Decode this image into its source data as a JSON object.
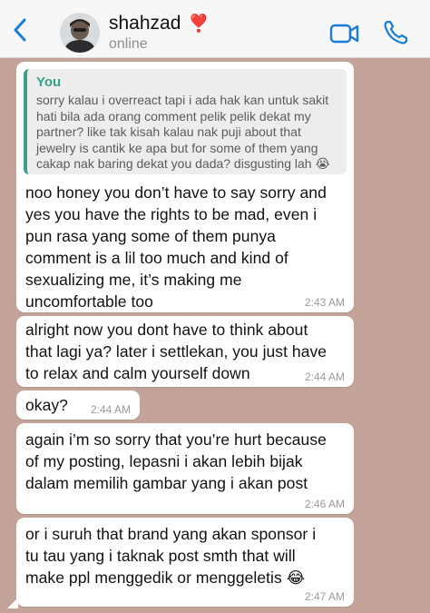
{
  "header": {
    "contact_name": "shahzad",
    "contact_emoji": "❣️",
    "status": "online",
    "icons": {
      "back": "chevron-left-icon",
      "video": "video-camera-icon",
      "call": "phone-icon"
    },
    "accent_color": "#1a7cd6"
  },
  "messages": [
    {
      "quote_author": "You",
      "quote_text": "sorry kalau i overreact tapi i ada hak kan untuk sakit\nhati bila ada orang comment pelik pelik dekat my\npartner? like tak kisah kalau nak puji about that\njewelry is cantik ke apa but for some of them yang\ncakap nak baring dekat you dada? disgusting lah 😭",
      "text": "noo honey you don’t have to say sorry and\nyes you have the rights to be mad, even i\npun rasa yang some of them punya\ncomment is a lil too much and kind of\nsexualizing me, it’s making me\nuncomfortable too",
      "time": "2:43 AM"
    },
    {
      "text": "alright now you dont have to think about\nthat lagi ya? later i settlekan, you just have\nto relax and calm yourself down",
      "time": "2:44 AM"
    },
    {
      "text": "okay?",
      "time": "2:44 AM"
    },
    {
      "text": "again i’m so sorry that you’re hurt because\nof my posting, lepasni i akan lebih bijak\ndalam memilih gambar yang i akan post",
      "time": "2:46 AM"
    },
    {
      "text": "or i suruh that brand yang akan sponsor i\ntu tau yang i taknak post smth that will\nmake ppl menggedik or menggeletis 😂",
      "time": "2:47 AM"
    }
  ],
  "colors": {
    "chat_background": "#c4a49a",
    "bubble": "#ffffff",
    "quote_accent": "#35a18a"
  }
}
